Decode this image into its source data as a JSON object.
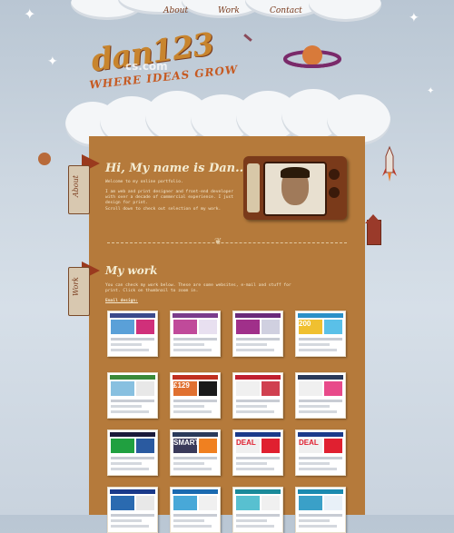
{
  "nav": {
    "about": "About",
    "work": "Work",
    "contact": "Contact"
  },
  "logo": {
    "name": "dan123",
    "tagline": "WHERE IDEAS GROW",
    "watermark": "cs.com"
  },
  "about": {
    "heading": "Hi, My name is Dan...",
    "tab": "About",
    "p1": "Welcome to my online portfolio.",
    "p2": "I am web and print designer and front-end developer with over a decade of commercial experience. I just design for print.",
    "p3": "Scroll down to check out selection of my work."
  },
  "work": {
    "heading": "My work",
    "tab": "Work",
    "intro": "You can check my work below. These are some websites, e-mail and stuff for print. Click on thumbnail to zoom in.",
    "subheading": "Email design:"
  },
  "thumbs": [
    {
      "bar": "#3b4a8c",
      "img": "#5aa0d8",
      "blk": "#d0307a",
      "label": ""
    },
    {
      "bar": "#7a3c8c",
      "img": "#c04a9a",
      "blk": "#e8e0f0",
      "label": ""
    },
    {
      "bar": "#6a2a7a",
      "img": "#a0308a",
      "blk": "#d0d0e0",
      "label": ""
    },
    {
      "bar": "#2a90c8",
      "img": "#f0c030",
      "blk": "#5ac0e8",
      "label": "200"
    },
    {
      "bar": "#3a8a3a",
      "img": "#88c0e0",
      "blk": "#e8e8e8",
      "label": ""
    },
    {
      "bar": "#c03020",
      "img": "#e07030",
      "blk": "#1a1a1a",
      "label": "£129"
    },
    {
      "bar": "#c02030",
      "img": "#f0f0f0",
      "blk": "#d04050",
      "label": ""
    },
    {
      "bar": "#2a3a5a",
      "img": "#f0f0f0",
      "blk": "#e84a8a",
      "label": ""
    },
    {
      "bar": "#1a1a3a",
      "img": "#20a040",
      "blk": "#2a5aa0",
      "label": ""
    },
    {
      "bar": "#2a3a5a",
      "img": "#3a3a5a",
      "blk": "#f08020",
      "label": "SMART"
    },
    {
      "bar": "#1a3a8a",
      "img": "#f0f0f0",
      "blk": "#e02030",
      "label": "DEAL"
    },
    {
      "bar": "#1a3a8a",
      "img": "#f0f0f0",
      "blk": "#e02030",
      "label": "DEAL"
    },
    {
      "bar": "#1a3a8a",
      "img": "#2a6ab0",
      "blk": "#e8e8e8",
      "label": ""
    },
    {
      "bar": "#1a6ab0",
      "img": "#48a8d8",
      "blk": "#f0f0f0",
      "label": ""
    },
    {
      "bar": "#1a8a9a",
      "img": "#58c0d0",
      "blk": "#f0f0f0",
      "label": ""
    },
    {
      "bar": "#1a8ab0",
      "img": "#3aa0c8",
      "blk": "#e8f0f8",
      "label": ""
    }
  ]
}
